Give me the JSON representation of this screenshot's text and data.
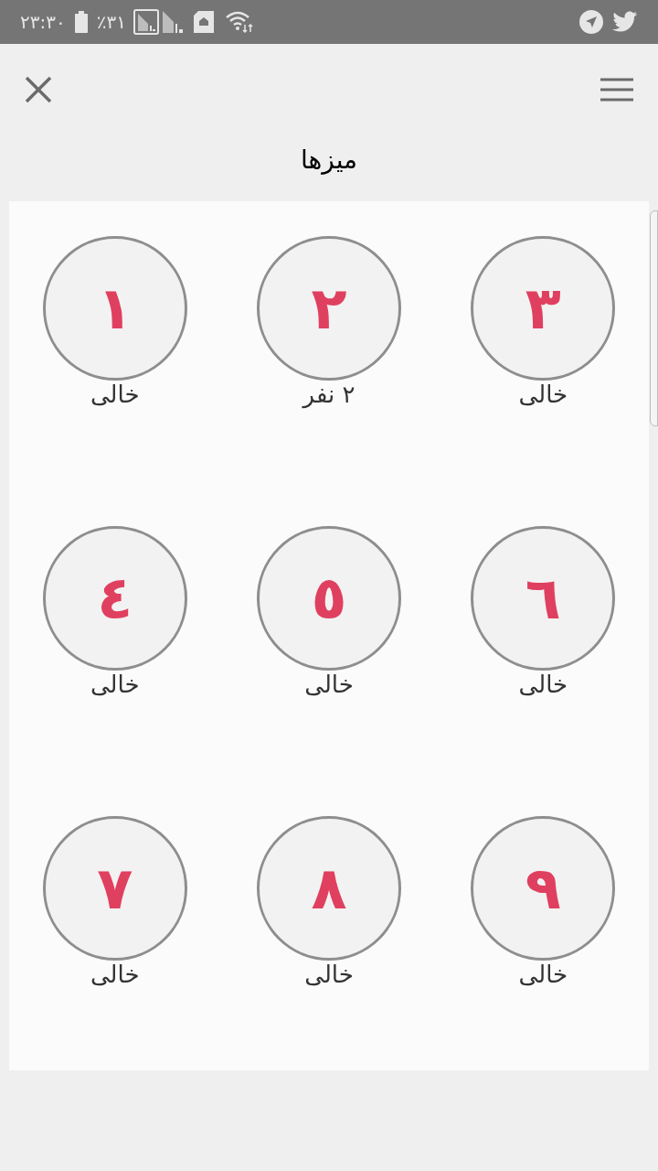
{
  "status_bar": {
    "time": "۲۳:۳۰",
    "battery": "٪۳۱"
  },
  "title": "میزها",
  "tables": [
    {
      "number": "٣",
      "status": "خالی"
    },
    {
      "number": "٢",
      "status": "۲ نفر"
    },
    {
      "number": "١",
      "status": "خالی"
    },
    {
      "number": "٦",
      "status": "خالی"
    },
    {
      "number": "٥",
      "status": "خالی"
    },
    {
      "number": "٤",
      "status": "خالی"
    },
    {
      "number": "٩",
      "status": "خالی"
    },
    {
      "number": "٨",
      "status": "خالی"
    },
    {
      "number": "٧",
      "status": "خالی"
    }
  ]
}
